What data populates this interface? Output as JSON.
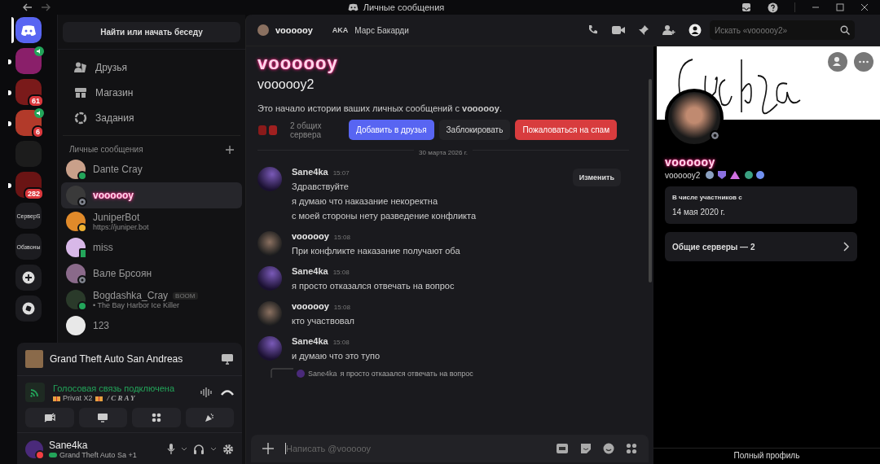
{
  "window": {
    "title": "Личные сообщения"
  },
  "servers": [
    {
      "kind": "image",
      "color": "#8a1f6a",
      "unread": true,
      "voice": true
    },
    {
      "kind": "image",
      "color": "#7a1a1a",
      "unread": true,
      "badge": "61"
    },
    {
      "kind": "image",
      "color": "#b23a2a",
      "unread": true,
      "voice": true,
      "badge": "6"
    },
    {
      "kind": "image",
      "color": "#1c1c1c"
    },
    {
      "kind": "image",
      "color": "#6a1414",
      "unread": true,
      "badge": "282"
    },
    {
      "kind": "text",
      "label": "СерверS"
    },
    {
      "kind": "text",
      "label": "Обзвоны"
    },
    {
      "kind": "add"
    },
    {
      "kind": "discover"
    }
  ],
  "sidebar": {
    "search": "Найти или начать беседу",
    "nav": [
      {
        "kind": "friends",
        "label": "Друзья"
      },
      {
        "kind": "shop",
        "label": "Магазин"
      },
      {
        "kind": "quests",
        "label": "Задания"
      }
    ],
    "dm_header": "Личные сообщения",
    "dms": [
      {
        "name": "Dante Cray",
        "kind": "dot",
        "selected": false,
        "styled": false,
        "color": "#23a55a"
      },
      {
        "name": "voooooy",
        "kind": "ring",
        "selected": true,
        "styled": true,
        "color": "#80848e"
      },
      {
        "name": "JuniperBot",
        "subtitle": "https://juniper.bot",
        "kind": "dot",
        "selected": false,
        "styled": false,
        "color": "#f0b232"
      },
      {
        "name": "miss",
        "kind": "phone",
        "selected": false,
        "styled": false,
        "color": "#23a55a"
      },
      {
        "name": "Вале Брсоян",
        "kind": "ring",
        "selected": false,
        "styled": false,
        "color": "#80848e"
      },
      {
        "name": "Bogdashka_Cray",
        "subtitle": "• The Bay Harbor Ice Killer",
        "tag": "BOOM",
        "kind": "dot",
        "selected": false,
        "styled": false,
        "color": "#23a55a"
      },
      {
        "name": "123",
        "kind": "plain",
        "selected": false,
        "styled": false
      }
    ]
  },
  "activity": {
    "game": "Grand Theft Auto San Andreas"
  },
  "voice": {
    "status": "Голосовая связь подключена",
    "channel": "Privat X2",
    "server": "/ C R A Y"
  },
  "user": {
    "name": "Sane4ka",
    "status_text": "Grand Theft Auto Sa +1",
    "color": "#f23f43"
  },
  "header": {
    "name": "voooooy",
    "aka": "AKA",
    "alias": "Марс Бакарди",
    "search_placeholder": "Искать «voooooy2»"
  },
  "intro": {
    "display_name": "voooooy",
    "username": "voooooy2",
    "text": "Это начало истории ваших личных сообщений с **voooooy**.",
    "mutual": "2 общих сервера",
    "buttons": [
      {
        "kind": "primary",
        "label": "Добавить в друзья"
      },
      {
        "kind": "secondary",
        "label": "Заблокировать"
      },
      {
        "kind": "danger",
        "label": "Пожаловаться на спам"
      }
    ]
  },
  "date_divider": "30 марта 2026 г.",
  "tooltip": "Изменить",
  "messages": [
    {
      "author": "Sane4ka",
      "self": true,
      "time": "15:07",
      "lines": [
        "Здравствуйте",
        "я думаю что наказание некоректна",
        "с моей стороны нету разведение конфликта"
      ]
    },
    {
      "author": "voooooy",
      "self": false,
      "time": "15:08",
      "lines": [
        "При конфликте наказание получают оба"
      ]
    },
    {
      "author": "Sane4ka",
      "self": true,
      "time": "15:08",
      "lines": [
        "я просто отказался отвечать на вопрос"
      ]
    },
    {
      "author": "voooooy",
      "self": false,
      "time": "15:08",
      "lines": [
        "кто участвовал"
      ]
    },
    {
      "author": "Sane4ka",
      "self": true,
      "time": "15:08",
      "lines": [
        "и думаю что это тупо"
      ]
    }
  ],
  "reply": {
    "author": "Sane4ka",
    "text": "я просто отказался отвечать на вопрос"
  },
  "composer": {
    "placeholder": "Написать @voooooy"
  },
  "profile": {
    "display_name": "voooooy",
    "username": "voooooy2",
    "member_label": "В числе участников с",
    "member_since": "14 мая 2020 г.",
    "mutual_servers": "Общие серверы — 2",
    "full_profile": "Полный профиль"
  }
}
